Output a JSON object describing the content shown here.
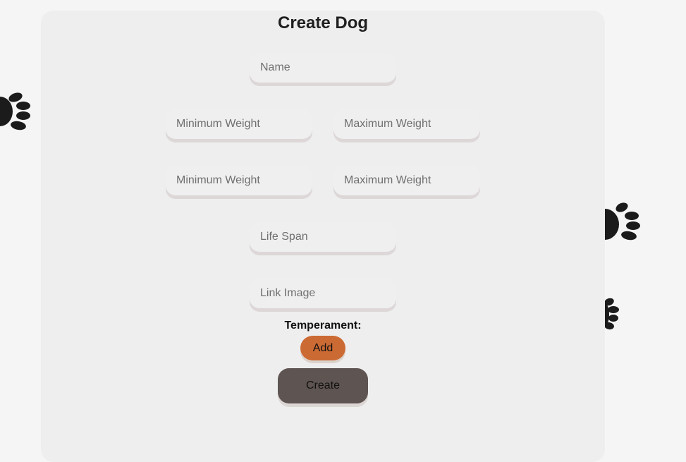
{
  "form": {
    "title": "Create Dog",
    "name_placeholder": "Name",
    "height_min_placeholder": "Minimum Weight",
    "height_max_placeholder": "Maximum Weight",
    "weight_min_placeholder": "Minimum Weight",
    "weight_max_placeholder": "Maximum Weight",
    "life_span_placeholder": "Life Span",
    "image_placeholder": "Link Image",
    "temperament_label": "Temperament:",
    "add_label": "Add",
    "create_label": "Create"
  },
  "colors": {
    "page_background": "#f5f5f5",
    "card_background": "#eeeeee",
    "add_button": "#cc6a34",
    "create_button": "#5e5451",
    "paw": "#1b1b1b"
  },
  "icons": [
    "paw-print-icon"
  ]
}
